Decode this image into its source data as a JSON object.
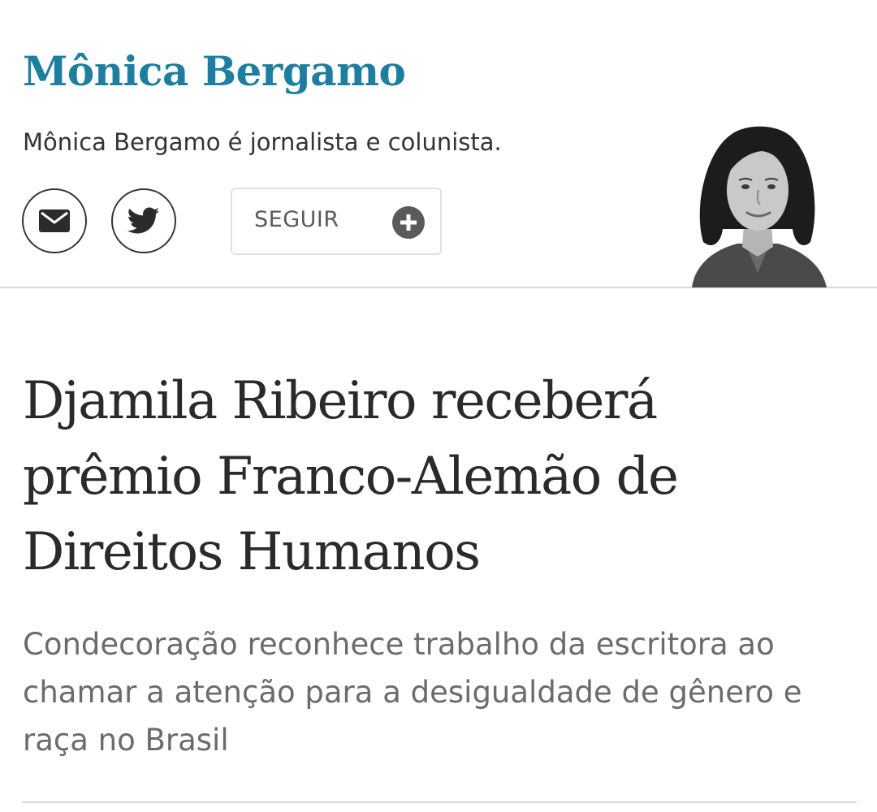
{
  "columnist": {
    "name": "Mônica Bergamo",
    "bio": "Mônica Bergamo é jornalista e colunista.",
    "name_color": "#1a7fa3"
  },
  "social": {
    "email_icon": "mail-icon",
    "twitter_icon": "twitter-bird-icon"
  },
  "follow": {
    "label": "SEGUIR",
    "icon": "plus-circle-icon"
  },
  "article": {
    "headline": "Djamila Ribeiro receberá prêmio Franco-Alemão de Direitos Humanos",
    "subheadline": "Condecoração reconhece trabalho da escritora ao chamar a atenção para a desigualdade de gênero e raça no Brasil"
  }
}
